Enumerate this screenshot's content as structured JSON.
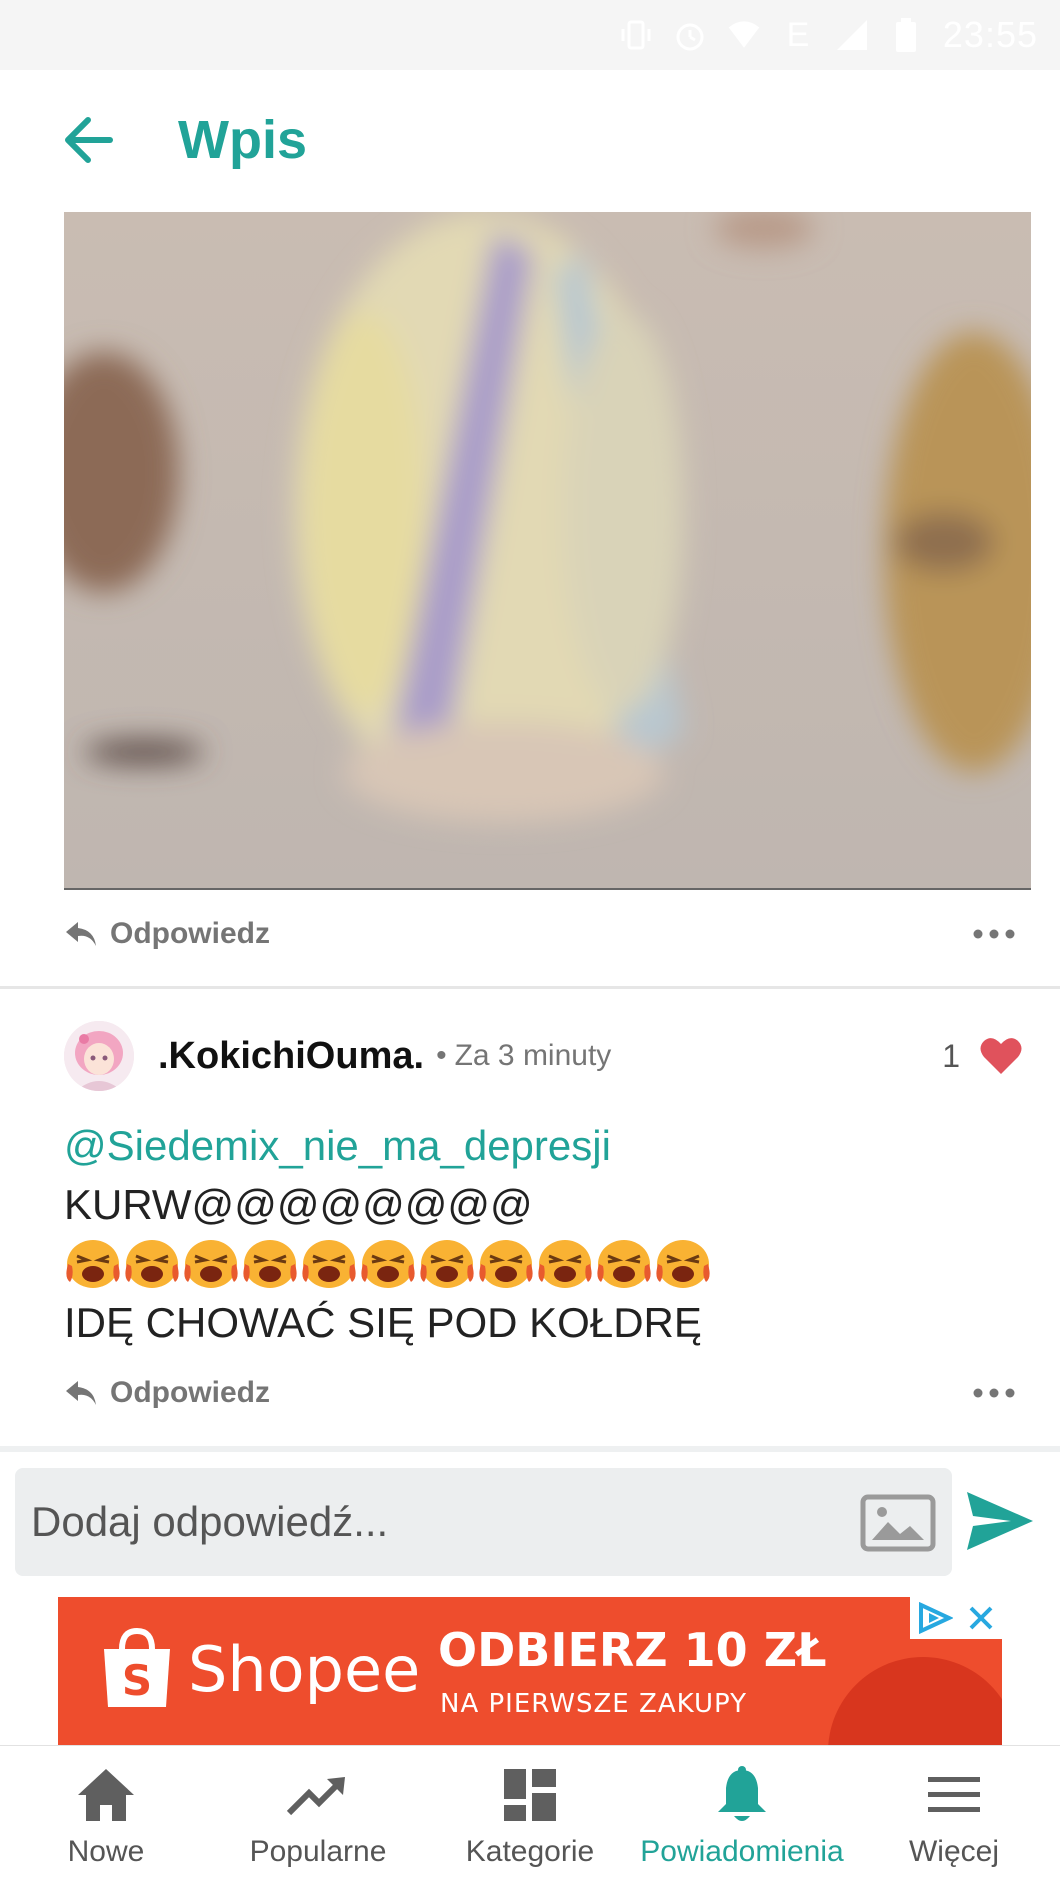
{
  "status_bar": {
    "time": "23:55",
    "network": "E"
  },
  "app_bar": {
    "title": "Wpis"
  },
  "post": {
    "reply_label": "Odpowiedz"
  },
  "comment": {
    "username": ".KokichiOuma.",
    "separator": "•",
    "timestamp": "Za 3 minuty",
    "like_count": "1",
    "mention": "@Siedemix_nie_ma_depresji",
    "line1": "KURW@@@@@@@@",
    "emoji_count_shown": 11,
    "line3": "IDĘ CHOWAĆ SIĘ POD KOŁDRĘ",
    "reply_label": "Odpowiedz"
  },
  "reply_box": {
    "placeholder": "Dodaj odpowiedź..."
  },
  "ad": {
    "brand": "Shopee",
    "headline": "ODBIERZ 10 ZŁ",
    "subline": "NA PIERWSZE ZAKUPY"
  },
  "bottom_nav": {
    "items": [
      {
        "label": "Nowe",
        "icon": "home-icon"
      },
      {
        "label": "Popularne",
        "icon": "trending-icon"
      },
      {
        "label": "Kategorie",
        "icon": "dashboard-icon"
      },
      {
        "label": "Powiadomienia",
        "icon": "bell-icon",
        "active": true
      },
      {
        "label": "Więcej",
        "icon": "menu-icon"
      }
    ]
  },
  "colors": {
    "accent": "#21a398",
    "heart": "#e0525c",
    "ad_bg": "#ee4d2d"
  }
}
